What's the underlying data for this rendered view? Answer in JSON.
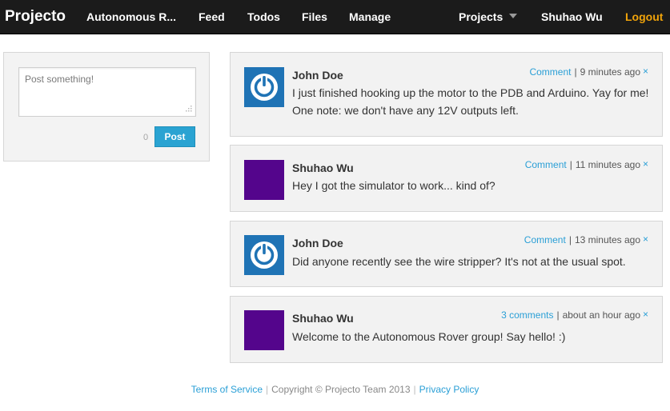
{
  "navbar": {
    "brand": "Projecto",
    "items": [
      "Autonomous R...",
      "Feed",
      "Todos",
      "Files",
      "Manage"
    ],
    "projects": "Projects",
    "user": "Shuhao Wu",
    "logout": "Logout"
  },
  "composer": {
    "placeholder": "Post something!",
    "char_count": "0",
    "post_label": "Post"
  },
  "posts": [
    {
      "author": "John Doe",
      "avatar": "power-icon",
      "comment_label": "Comment",
      "time": "9 minutes ago",
      "close": "×",
      "body": "I just finished hooking up the motor to the PDB and Arduino. Yay for me! One note: we don't have any 12V outputs left."
    },
    {
      "author": "Shuhao Wu",
      "avatar": "purple-square",
      "comment_label": "Comment",
      "time": "11 minutes ago",
      "close": "×",
      "body": "Hey I got the simulator to work... kind of?"
    },
    {
      "author": "John Doe",
      "avatar": "power-icon",
      "comment_label": "Comment",
      "time": "13 minutes ago",
      "close": "×",
      "body": "Did anyone recently see the wire stripper? It's not at the usual spot."
    },
    {
      "author": "Shuhao Wu",
      "avatar": "purple-square",
      "comment_label": "3 comments",
      "time": "about an hour ago",
      "close": "×",
      "body": "Welcome to the Autonomous Rover group! Say hello! :)"
    }
  ],
  "footer": {
    "terms": "Terms of Service",
    "sep": "|",
    "copyright": "Copyright © Projecto Team 2013",
    "privacy": "Privacy Policy"
  },
  "colors": {
    "navbar_bg": "#1b1b1b",
    "link": "#2a9fd6",
    "logout": "#f0a30a",
    "avatar_blue": "#1f73b5",
    "avatar_purple": "#54058c"
  }
}
